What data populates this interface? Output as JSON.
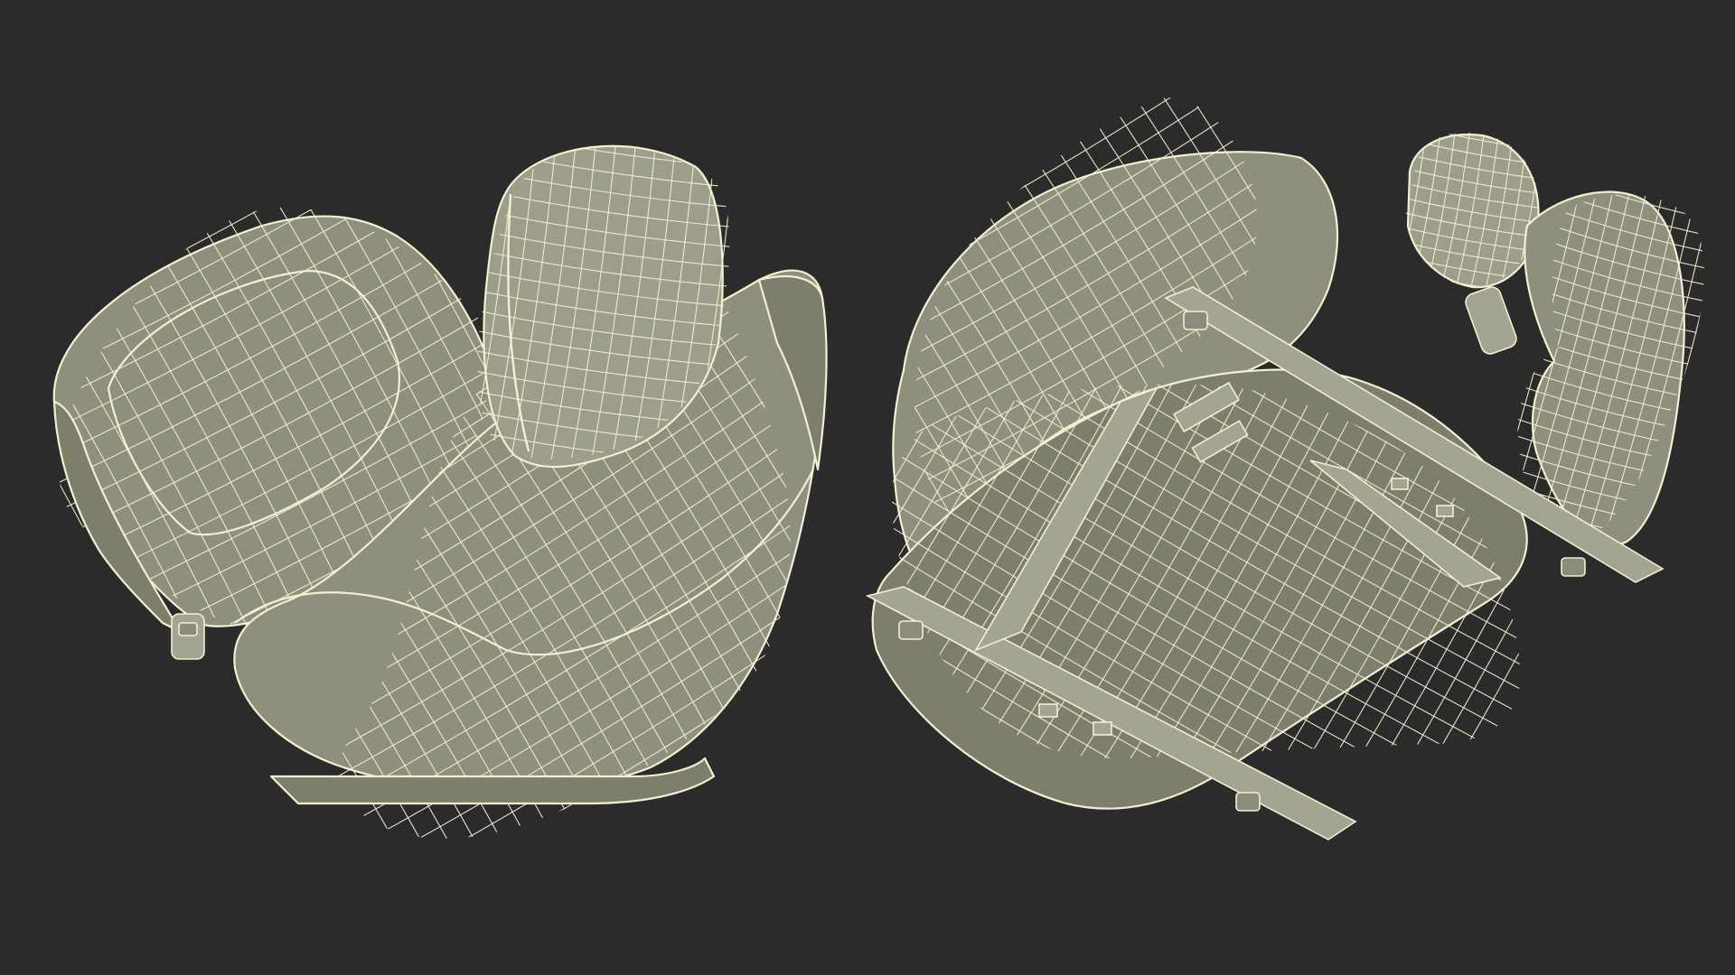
{
  "scene": {
    "background_color": "#2b2b2b",
    "mesh_fill_color": "#8e8f7d",
    "wire_color": "#f1edd0",
    "objects": [
      {
        "id": "seat-top-view",
        "view": "top-front"
      },
      {
        "id": "seat-bottom-view",
        "view": "underside"
      }
    ]
  }
}
